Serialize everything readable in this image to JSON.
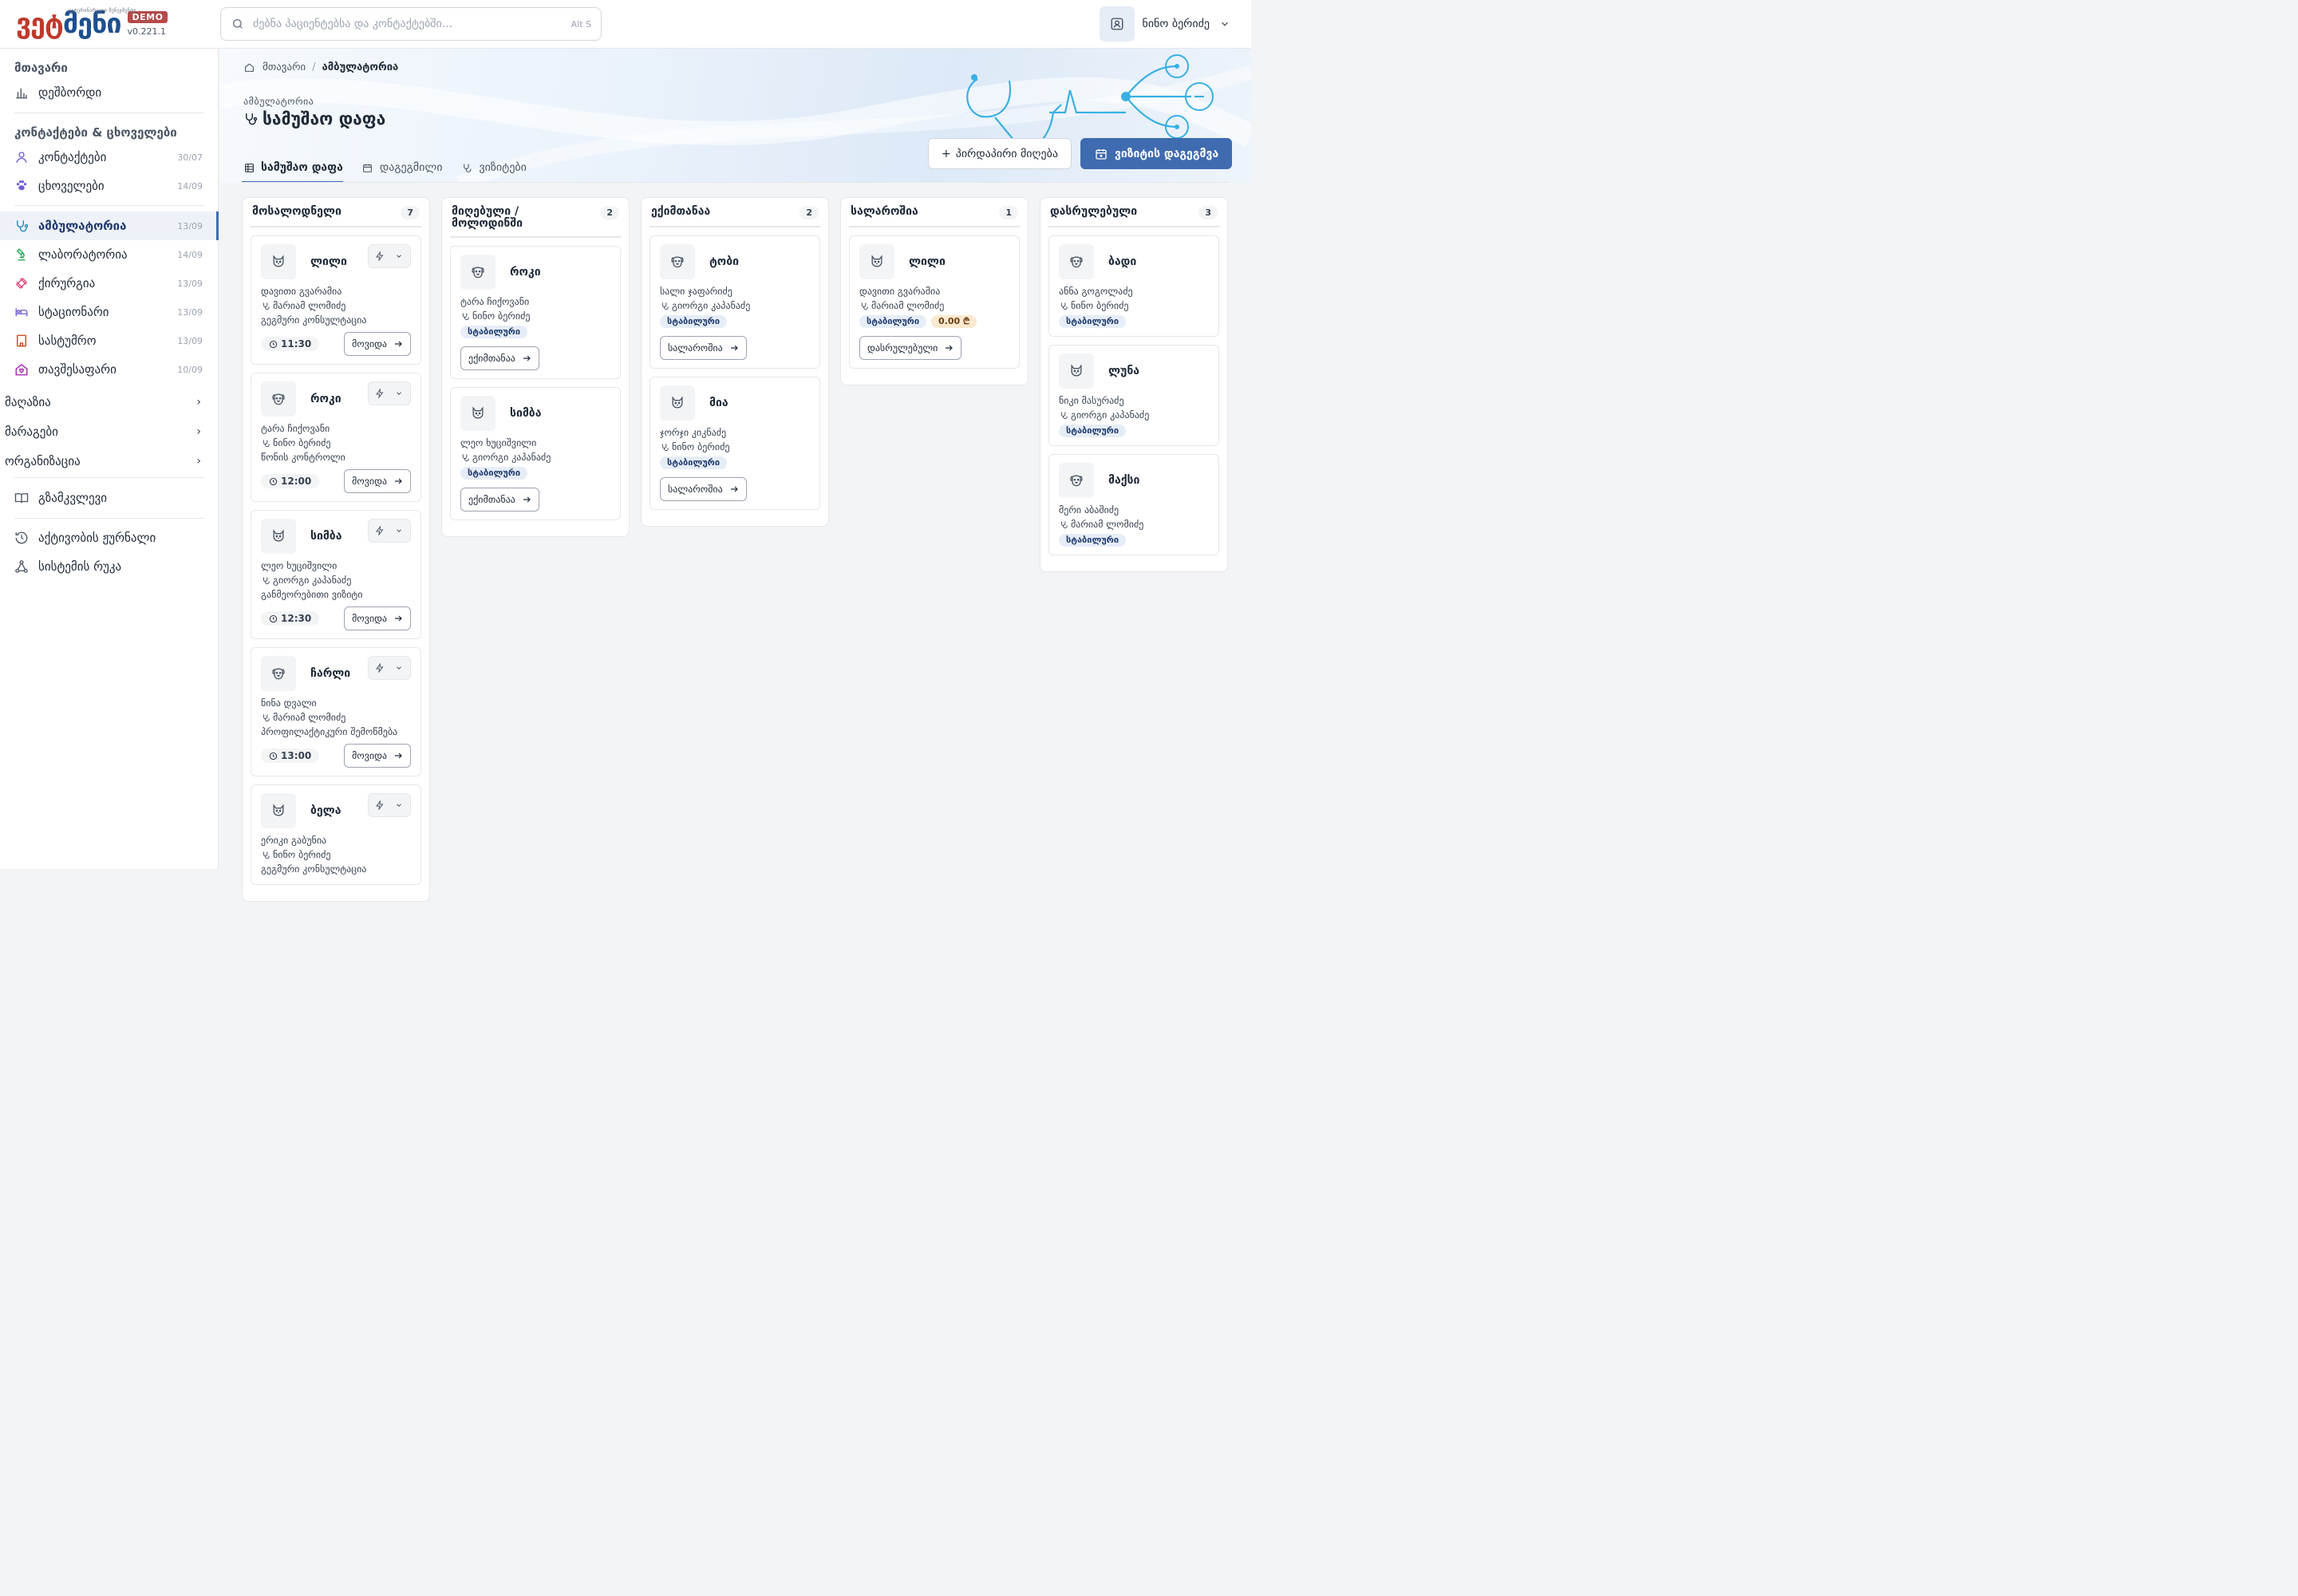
{
  "header": {
    "logo_text_a": "ვეტ",
    "logo_text_b": "მენი",
    "logo_tagline": "ვეტერინარული მენეჯმენტი",
    "demo_badge": "DEMO",
    "version": "v0.221.1",
    "search_placeholder": "ძებნა პაციენტებსა და კონტაქტებში...",
    "search_shortcut": "Alt S",
    "user_name": "ნინო ბერიძე"
  },
  "sidebar": {
    "main_section": "მთავარი",
    "dashboard": "დეშბორდი",
    "contacts_section": "კონტაქტები & ცხოველები",
    "contacts": {
      "label": "კონტაქტები",
      "date": "30/07"
    },
    "animals": {
      "label": "ცხოველები",
      "date": "14/09"
    },
    "ambulatory": {
      "label": "ამბულატორია",
      "date": "13/09"
    },
    "laboratory": {
      "label": "ლაბორატორია",
      "date": "14/09"
    },
    "surgery": {
      "label": "ქირურგია",
      "date": "13/09"
    },
    "hospital": {
      "label": "სტაციონარი",
      "date": "13/09"
    },
    "hotel": {
      "label": "სასტუმრო",
      "date": "13/09"
    },
    "shelter": {
      "label": "თავშესაფარი",
      "date": "10/09"
    },
    "shop": "მაღაზია",
    "stock": "მარაგები",
    "organization": "ორგანიზაცია",
    "guide": "გზამკვლევი",
    "activity_log": "აქტივობის ჟურნალი",
    "system_map": "სისტემის რუკა"
  },
  "page": {
    "breadcrumb_home": "მთავარი",
    "breadcrumb_current": "ამბულატორია",
    "subtitle": "ამბულატორია",
    "title": "სამუშაო დაფა",
    "tabs": [
      "სამუშაო დაფა",
      "დაგეგმილი",
      "ვიზიტები"
    ],
    "btn_direct": "პირდაპირი მიღება",
    "btn_schedule": "ვიზიტის დაგეგმვა"
  },
  "board": {
    "columns": [
      {
        "title": "მოსალოდნელი",
        "count": "7",
        "cards": [
          {
            "pet": "ლილი",
            "icon": "cat",
            "owner": "დავითი გვარამია",
            "doctor": "მარიამ ლომიძე",
            "reason": "გეგმური კონსულტაცია",
            "time": "11:30",
            "action": "მოვიდა"
          },
          {
            "pet": "როკი",
            "icon": "dog",
            "owner": "ტარა ჩიქოვანი",
            "doctor": "ნინო ბერიძე",
            "reason": "წონის კონტროლი",
            "time": "12:00",
            "action": "მოვიდა"
          },
          {
            "pet": "სიმბა",
            "icon": "cat",
            "owner": "ლეო ხუციშვილი",
            "doctor": "გიორგი კაპანაძე",
            "reason": "განმეორებითი ვიზიტი",
            "time": "12:30",
            "action": "მოვიდა"
          },
          {
            "pet": "ჩარლი",
            "icon": "dog",
            "owner": "ნინა დვალი",
            "doctor": "მარიამ ლომიძე",
            "reason": "პროფილაქტიკური შემოწმება",
            "time": "13:00",
            "action": "მოვიდა"
          },
          {
            "pet": "ბელა",
            "icon": "cat",
            "owner": "ერიკი გაბუნია",
            "doctor": "ნინო ბერიძე",
            "reason": "გეგმური კონსულტაცია",
            "time": "",
            "action": ""
          }
        ]
      },
      {
        "title": "მიღებული / მოლოდინში",
        "count": "2",
        "cards": [
          {
            "pet": "როკი",
            "icon": "dog",
            "owner": "ტარა ჩიქოვანი",
            "doctor": "ნინო ბერიძე",
            "badge": "სტაბილური",
            "action": "ექიმთანაა"
          },
          {
            "pet": "სიმბა",
            "icon": "cat",
            "owner": "ლეო ხუციშვილი",
            "doctor": "გიორგი კაპანაძე",
            "badge": "სტაბილური",
            "action": "ექიმთანაა"
          }
        ]
      },
      {
        "title": "ექიმთანაა",
        "count": "2",
        "cards": [
          {
            "pet": "ტობი",
            "icon": "dog",
            "owner": "სალი ჯაფარიძე",
            "doctor": "გიორგი კაპანაძე",
            "badge": "სტაბილური",
            "action": "სალაროშია"
          },
          {
            "pet": "მია",
            "icon": "cat",
            "owner": "ჯორჯი კიკნაძე",
            "doctor": "ნინო ბერიძე",
            "badge": "სტაბილური",
            "action": "სალაროშია"
          }
        ]
      },
      {
        "title": "სალაროშია",
        "count": "1",
        "cards": [
          {
            "pet": "ლილი",
            "icon": "cat",
            "owner": "დავითი გვარამია",
            "doctor": "მარიამ ლომიძე",
            "badge": "სტაბილური",
            "money": "0.00 ₾",
            "action": "დასრულებული"
          }
        ]
      },
      {
        "title": "დასრულებული",
        "count": "3",
        "cards": [
          {
            "pet": "ბადი",
            "icon": "dog",
            "owner": "ანნა გოგოლაძე",
            "doctor": "ნინო ბერიძე",
            "badge": "სტაბილური"
          },
          {
            "pet": "ლუნა",
            "icon": "cat",
            "owner": "ნიკი მასურაძე",
            "doctor": "გიორგი კაპანაძე",
            "badge": "სტაბილური"
          },
          {
            "pet": "მაქსი",
            "icon": "dog",
            "owner": "მერი აბაშიძე",
            "doctor": "მარიამ ლომიძე",
            "badge": "სტაბილური"
          }
        ]
      }
    ]
  },
  "colors": {
    "accent": "#3f6bb0",
    "logo_red": "#c0392b",
    "logo_blue": "#1e4f8f"
  }
}
